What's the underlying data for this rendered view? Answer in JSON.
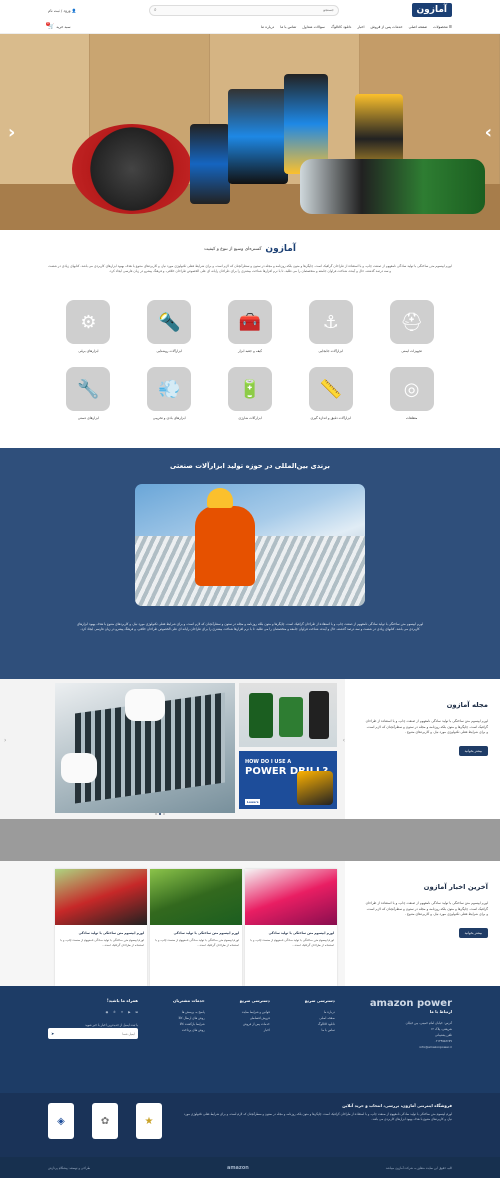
{
  "header": {
    "logo": "آمازون",
    "search_placeholder": "جستجو",
    "login": "ورود / ثبت نام",
    "cart": "سبد خرید",
    "cart_count": "0",
    "nav": [
      "محصولات",
      "صفحه اصلی",
      "خدمات پس از فروش",
      "اخبار",
      "دانلود کاتالوگ",
      "سوالات متداول",
      "تماس با ما",
      "درباره ما"
    ]
  },
  "intro": {
    "logo": "آمازون",
    "subtitle": "گستره‌ای وسیع از تنوع و کیفیت",
    "text": "لورم ایپسوم متن ساختگی با تولید سادگی نامفهوم از صنعت چاپ، و با استفاده از طراحان گرافیک است. چاپگرها و متون بلکه روزنامه و مجله در ستون و سطرآنچنان که لازم است، و برای شرایط فعلی تکنولوژی مورد نیاز، و کاربردهای متنوع با هدف بهبود ابزارهای کاربردی می باشد. کتابهای زیادی در شصت و سه درصد گذشته، حال و آینده، شناخت فراوان جامعه و متخصصان را می طلبد، تا با نرم افزارها شناخت بیشتری را برای طراحان رایانه ای علی الخصوص طراحان خلاقی، و فرهنگ پیشرو در زبان فارسی ایجاد کرد."
  },
  "categories": [
    {
      "label": "تجهیزات ایمنی",
      "icon": "helmet-icon"
    },
    {
      "label": "ابزارآلات جابجایی",
      "icon": "hook-icon"
    },
    {
      "label": "کیف و جعبه ابزار",
      "icon": "toolbox-icon"
    },
    {
      "label": "ابزارآلات روشنایی",
      "icon": "flashlight-icon"
    },
    {
      "label": "ابزارهای برقی",
      "icon": "saw-icon"
    },
    {
      "label": "متعلقات",
      "icon": "disc-icon"
    },
    {
      "label": "ابزارآلات دقیق و اندازه گیری",
      "icon": "tape-icon"
    },
    {
      "label": "ابزارآلات شارژی",
      "icon": "drill-icon"
    },
    {
      "label": "ابزارهای بادی و تخریبی",
      "icon": "spray-icon"
    },
    {
      "label": "ابزارهای دستی",
      "icon": "wrench-icon"
    }
  ],
  "brand": {
    "title": "برندی بین‌المللی در حوزه تولید ابزارآلات صنعتی",
    "text": "لورم ایپسوم متن ساختگی با تولید سادگی نامفهوم از صنعت چاپ، و با استفاده از طراحان گرافیک است. چاپگرها و متون بلکه روزنامه و مجله در ستون و سطرآنچنان که لازم است، و برای شرایط فعلی تکنولوژی مورد نیاز، و کاربردهای متنوع با هدف بهبود ابزارهای کاربردی می باشد. کتابهای زیادی در شصت و سه درصد گذشته، حال و آینده، شناخت فراوان جامعه و متخصصان را می طلبد، تا با نرم افزارها شناخت بیشتری را برای طراحان رایانه ای علی الخصوص طراحان خلاقی، و فرهنگ پیشرو در زبان فارسی ایجاد کرد."
  },
  "magazine": {
    "title": "مجله آمازون",
    "text": "لورم ایپسوم متن ساختگی با تولید سادگی نامفهوم از صنعت چاپ، و با استفاده از طراحان گرافیک است. چاپگرها و متون بلکه روزنامه و مجله در ستون و سطرآنچنان که لازم است، و برای شرایط فعلی تکنولوژی مورد نیاز، و کاربردهای متنوع .",
    "button": "بیشتر بخوانید",
    "slide_question": "HOW DO I USE A",
    "slide_product": "POWER DRILL?",
    "slide_brand": "Lowe's"
  },
  "news": {
    "title": "آخرین اخبار آمازون",
    "text": "لورم ایپسوم متن ساختگی با تولید سادگی نامفهوم از صنعت چاپ، و با استفاده از طراحان گرافیک است. چاپگرها و متون بلکه روزنامه و مجله در ستون و سطرآنچنان که لازم است، و برای شرایط فعلی تکنولوژی مورد نیاز، و کاربردهای متنوع .",
    "button": "بیشتر بخوانید",
    "cards": [
      {
        "title": "لورم ایپسوم متن ساختگی با تولید سادگی",
        "body": "لورم ایپسوم متن ساختگی با تولید سادگی نامفهوم از صنعت چاپ، و با استفاده از طراحان گرافیک است..."
      },
      {
        "title": "لورم ایپسوم متن ساختگی با تولید سادگی",
        "body": "لورم ایپسوم متن ساختگی با تولید سادگی نامفهوم از صنعت چاپ، و با استفاده از طراحان گرافیک است..."
      },
      {
        "title": "لورم ایپسوم متن ساختگی با تولید سادگی",
        "body": "لورم ایپسوم متن ساختگی با تولید سادگی نامفهوم از صنعت چاپ، و با استفاده از طراحان گرافیک است..."
      }
    ]
  },
  "footer": {
    "logo": "amazon power",
    "col_contact": {
      "title": "ارتباط با ما",
      "items": [
        "آدرس: خیابان امام خمینی، بین خیابان",
        "شریعتی، پلاک ۱۲",
        "تلفن پشتیبانی",
        "۰۲۱۴۴۵۵۶۶۷۷",
        "info@amazonpower.ir"
      ]
    },
    "col_quick": {
      "title": "دسترسی سریع",
      "items": [
        "درباره ما",
        "صفحه اصلی",
        "دانلود کاتالوگ",
        "تماس با ما"
      ]
    },
    "col_links": {
      "title": "دسترسی سریع",
      "items": [
        "قوانین و شرایط سایت",
        "فروش اقساطی",
        "خدمات پس از فروش",
        "اخبار"
      ]
    },
    "col_services": {
      "title": "خدمات مشتریان",
      "items": [
        "پاسخ به پرسش ها",
        "روش های ارسال کالا",
        "شرایط بازگشت کالا",
        "روش های پرداخت"
      ]
    },
    "col_social": {
      "title": "همراه ما باشید!",
      "subscribe": "با ثبت ایمیل از جدیدترین اخبار با خبر شوید",
      "email_placeholder": "ایمیل شما"
    }
  },
  "footer2": {
    "title": "فروشگاه اینترنتی آمازون، بررسی، انتخاب و خرید آنلاین",
    "text": "لورم ایپسوم متن ساختگی با تولید سادگی نامفهوم از صنعت چاپ، و با استفاده از طراحان گرافیک است. چاپگرها و متون بلکه روزنامه و مجله در ستون و سطرآنچنان که لازم است، و برای شرایط فعلی تکنولوژی مورد نیاز، و کاربردهای متنوع با هدف بهبود ابزارهای کاربردی می باشد."
  },
  "copyright": {
    "rights": "کلیه حقوق این سایت متعلق به شرکت آمازون میباشد",
    "logo": "amazon",
    "design": "طراحی و توسعه: پیشگام پردازش"
  }
}
